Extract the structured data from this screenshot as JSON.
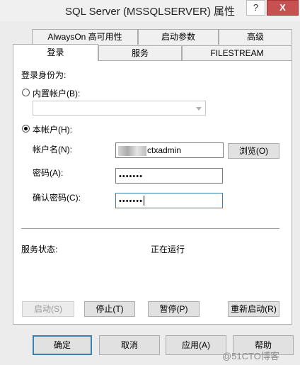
{
  "window": {
    "title": "SQL Server (MSSQLSERVER) 属性",
    "help_btn": "?",
    "close_btn": "X"
  },
  "tabs": {
    "row_back": [
      "AlwaysOn 高可用性",
      "启动参数",
      "高级"
    ],
    "row_front": [
      "登录",
      "服务",
      "FILESTREAM"
    ],
    "active": "登录"
  },
  "login": {
    "section_label": "登录身份为:",
    "builtin_label": "内置帐户(B):",
    "builtin_value": "",
    "this_account_label": "本帐户(H):",
    "account_name_label": "帐户名(N):",
    "account_name_value": "ctxadmin",
    "browse_button": "浏览(O)",
    "password_label": "密码(A):",
    "password_value": "•••••••",
    "confirm_label": "确认密码(C):",
    "confirm_value": "•••••••",
    "selected_option": "本帐户"
  },
  "service": {
    "status_label": "服务状态:",
    "status_value": "正在运行",
    "start_button": "启动(S)",
    "stop_button": "停止(T)",
    "pause_button": "暂停(P)",
    "restart_button": "重新启动(R)"
  },
  "dialog": {
    "ok_button": "确定",
    "cancel_button": "取消",
    "apply_button": "应用(A)",
    "help_button": "帮助"
  },
  "watermark": "@51CTO博客"
}
